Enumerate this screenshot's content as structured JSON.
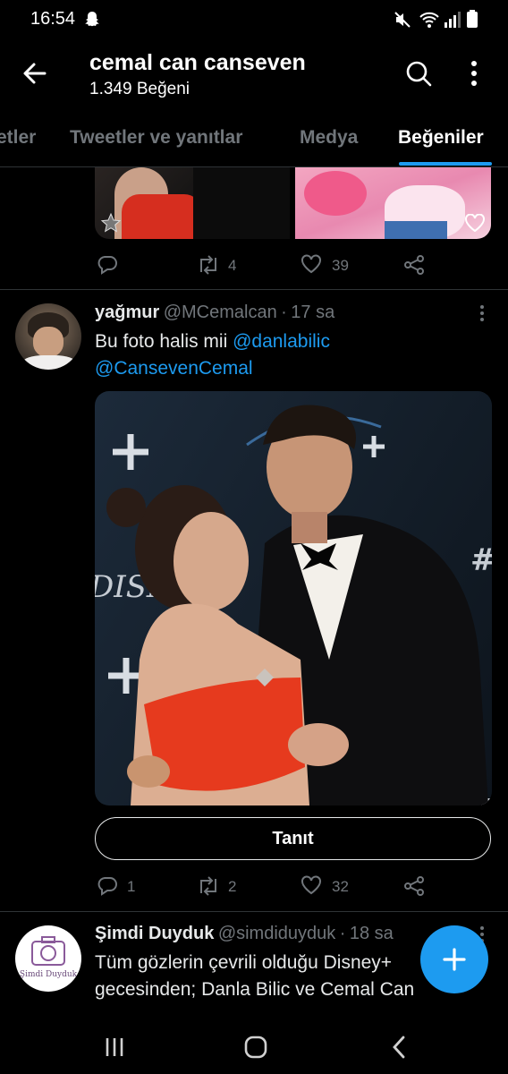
{
  "status_bar": {
    "time": "16:54"
  },
  "header": {
    "title": "cemal can canseven",
    "subtitle": "1.349 Beğeni"
  },
  "tabs": [
    {
      "label": "etler"
    },
    {
      "label": "Tweetler ve yanıtlar"
    },
    {
      "label": "Medya"
    },
    {
      "label": "Beğeniler"
    }
  ],
  "prev_tweet": {
    "actions": {
      "replies": "",
      "retweets": "4",
      "likes": "39"
    }
  },
  "tweet1": {
    "name": "yağmur",
    "handle": "@MCemalcan",
    "dot": "·",
    "time": "17 sa",
    "text_prefix": "Bu foto halis mii ",
    "mention1": "@danlabilic",
    "mention2": "@CansevenCemal",
    "promo_label": "Tanıt",
    "actions": {
      "replies": "1",
      "retweets": "2",
      "likes": "32"
    }
  },
  "tweet2": {
    "name": "Şimdi Duyduk",
    "handle": "@simdiduyduk",
    "dot": "·",
    "time": "18 sa",
    "avatar_text": "Şimdi Duyduk",
    "line1": "Tüm gözlerin çevrili olduğu Disney+",
    "line2": "gecesinden; Danla Bilic ve Cemal Can"
  },
  "icons": {
    "back": "back-arrow-icon",
    "search": "search-icon",
    "more": "more-vertical-icon",
    "reply": "reply-icon",
    "retweet": "retweet-icon",
    "like": "heart-icon",
    "share": "share-icon",
    "compose": "plus-icon"
  },
  "colors": {
    "accent": "#1d9bf0",
    "background": "#000000",
    "muted": "#71767b"
  }
}
